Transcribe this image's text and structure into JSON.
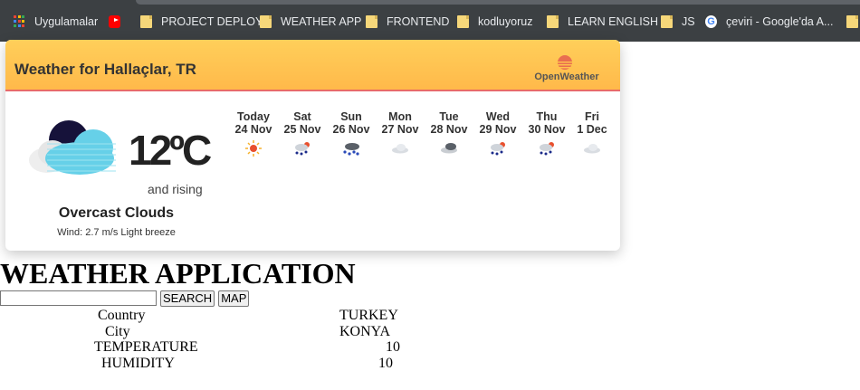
{
  "bookmarks": [
    {
      "label": "Uygulamalar",
      "icon": "apps-grid-icon"
    },
    {
      "label": "",
      "icon": "youtube-icon"
    },
    {
      "label": "PROJECT DEPLOY",
      "icon": "folder-icon"
    },
    {
      "label": "WEATHER APP",
      "icon": "folder-icon"
    },
    {
      "label": "FRONTEND",
      "icon": "folder-icon"
    },
    {
      "label": "kodluyoruz",
      "icon": "folder-icon"
    },
    {
      "label": "LEARN ENGLISH",
      "icon": "folder-icon"
    },
    {
      "label": "JS",
      "icon": "folder-icon"
    },
    {
      "label": "çeviri - Google'da A...",
      "icon": "google-icon"
    }
  ],
  "widget": {
    "title": "Weather for Hallaçlar, TR",
    "brand": "OpenWeather",
    "current": {
      "temperature": "12ºC",
      "trend": "and rising",
      "description": "Overcast Clouds",
      "wind": "Wind: 2.7 m/s Light breeze",
      "icon": "night-overcast-clouds-icon"
    },
    "forecast": [
      {
        "day": "Today",
        "date": "24 Nov",
        "icon": "sun-icon"
      },
      {
        "day": "Sat",
        "date": "25 Nov",
        "icon": "rain-snow-icon"
      },
      {
        "day": "Sun",
        "date": "26 Nov",
        "icon": "snow-cloud-icon"
      },
      {
        "day": "Mon",
        "date": "27 Nov",
        "icon": "cloud-icon"
      },
      {
        "day": "Tue",
        "date": "28 Nov",
        "icon": "dark-cloud-icon"
      },
      {
        "day": "Wed",
        "date": "29 Nov",
        "icon": "rain-snow-icon"
      },
      {
        "day": "Thu",
        "date": "30 Nov",
        "icon": "rain-snow-icon"
      },
      {
        "day": "Fri",
        "date": "1 Dec",
        "icon": "cloud-icon"
      }
    ]
  },
  "app": {
    "title": "WEATHER APPLICATION",
    "search_value": "",
    "search_button": "SEARCH",
    "map_button": "MAP",
    "rows": [
      {
        "label": "Country",
        "value": "TURKEY"
      },
      {
        "label": "City",
        "value": "KONYA"
      },
      {
        "label": "TEMPERATURE",
        "value": "10"
      },
      {
        "label": "HUMIDITY",
        "value": "10"
      }
    ]
  },
  "colors": {
    "header_top": "#ffcf5a",
    "header_bottom": "#ffb94a",
    "header_border": "#e86a6a",
    "bookmarks_bg": "#3c4043"
  }
}
